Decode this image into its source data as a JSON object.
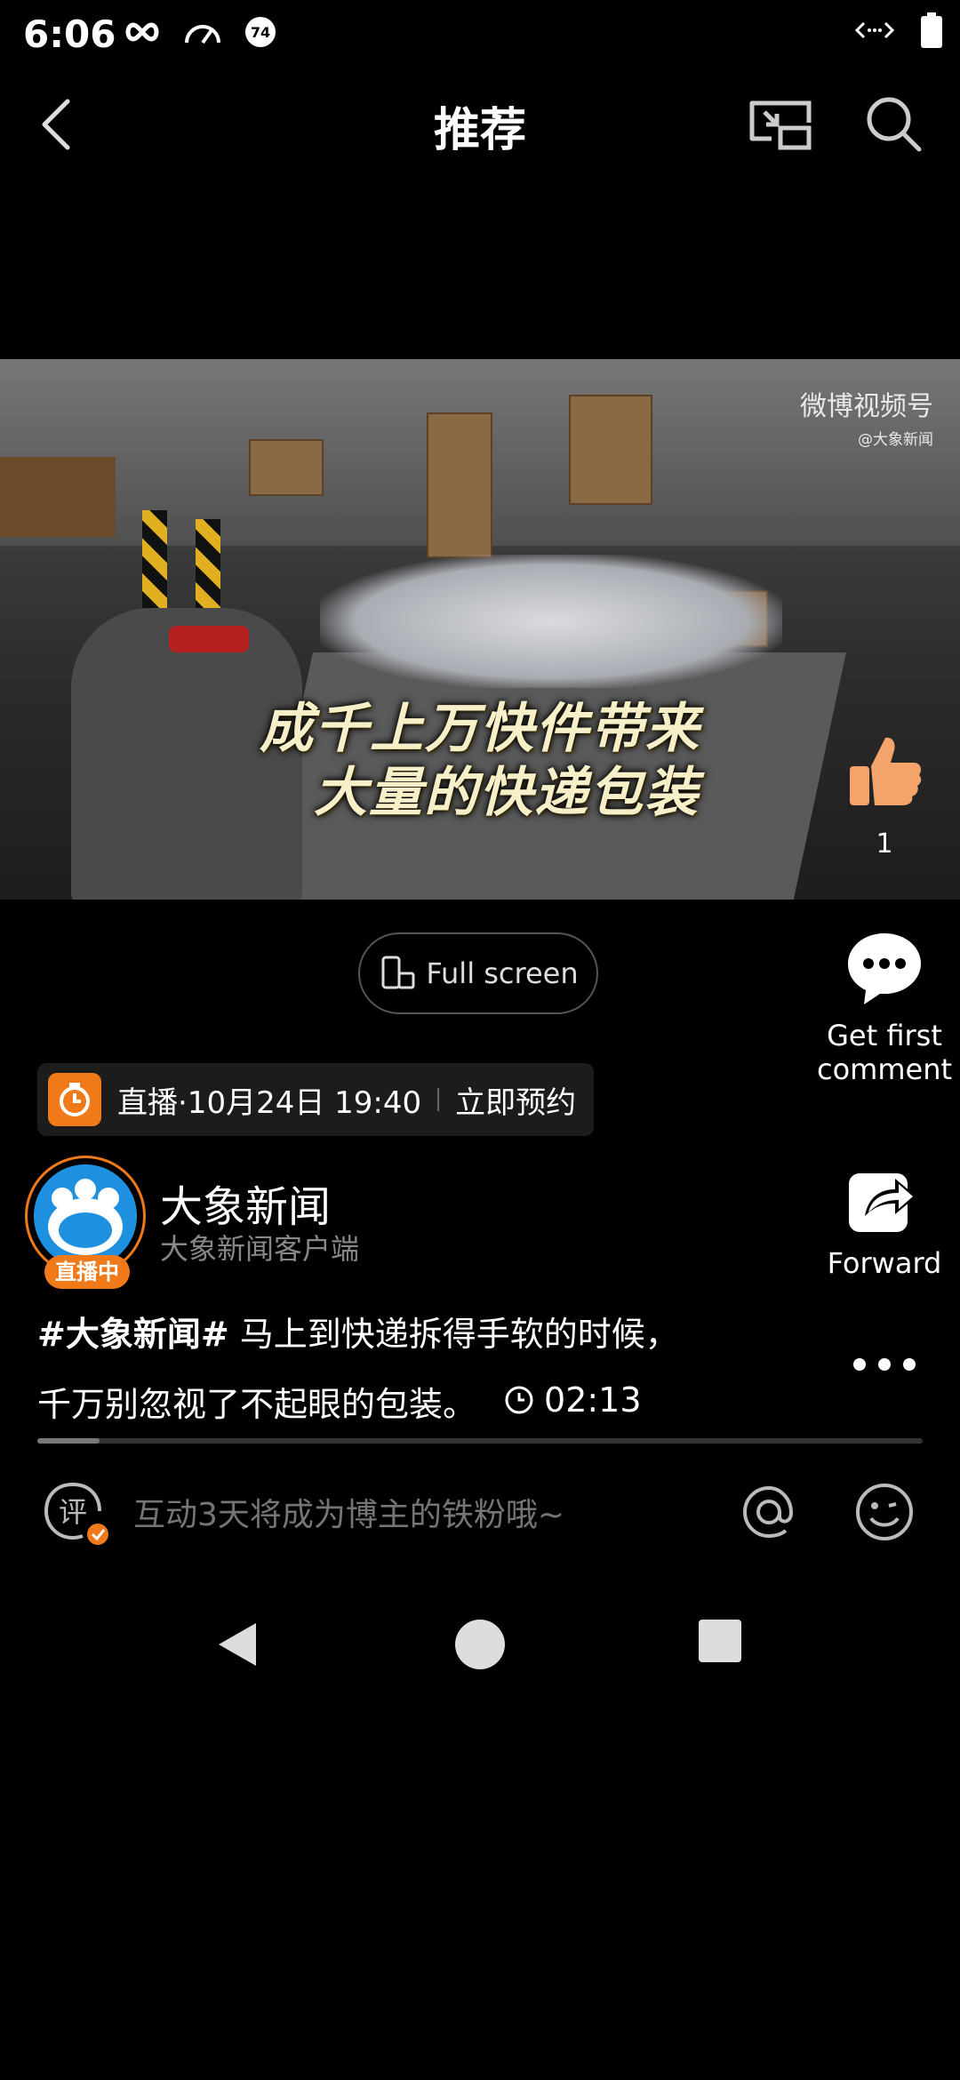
{
  "status_bar": {
    "time": "6:06",
    "icons": [
      "infinity-icon",
      "speedometer-icon",
      "notification-74-icon",
      "data-arrows-icon",
      "battery-icon"
    ],
    "badge_number": "74"
  },
  "header": {
    "title": "推荐",
    "icons": [
      "back-icon",
      "pip-icon",
      "search-icon"
    ]
  },
  "video": {
    "watermark_main": "微博视频号",
    "watermark_sub": "@大象新闻",
    "caption_line1": "成千上万快件带来",
    "caption_line2": "大量的快递包装",
    "like_count": "1"
  },
  "fullscreen": {
    "label": "Full screen"
  },
  "actions": {
    "comment_line1": "Get first",
    "comment_line2": "comment",
    "forward_label": "Forward"
  },
  "live": {
    "text": "直播·10月24日 19:40",
    "reserve": "立即预约"
  },
  "author": {
    "name": "大象新闻",
    "subtitle": "大象新闻客户端",
    "live_tag": "直播中"
  },
  "post": {
    "hashtag": "#大象新闻#",
    "text_line1": " 马上到快递拆得手软的时候，",
    "text_line2": "千万别忽视了不起眼的包装。",
    "duration": "02:13"
  },
  "playback": {
    "progress": 0.07
  },
  "comment_bar": {
    "icon_char": "评",
    "placeholder": "互动3天将成为博主的铁粉哦~"
  },
  "colors": {
    "accent_orange": "#f07a1a",
    "background": "#000000",
    "avatar_blue": "#1f8fe0"
  }
}
